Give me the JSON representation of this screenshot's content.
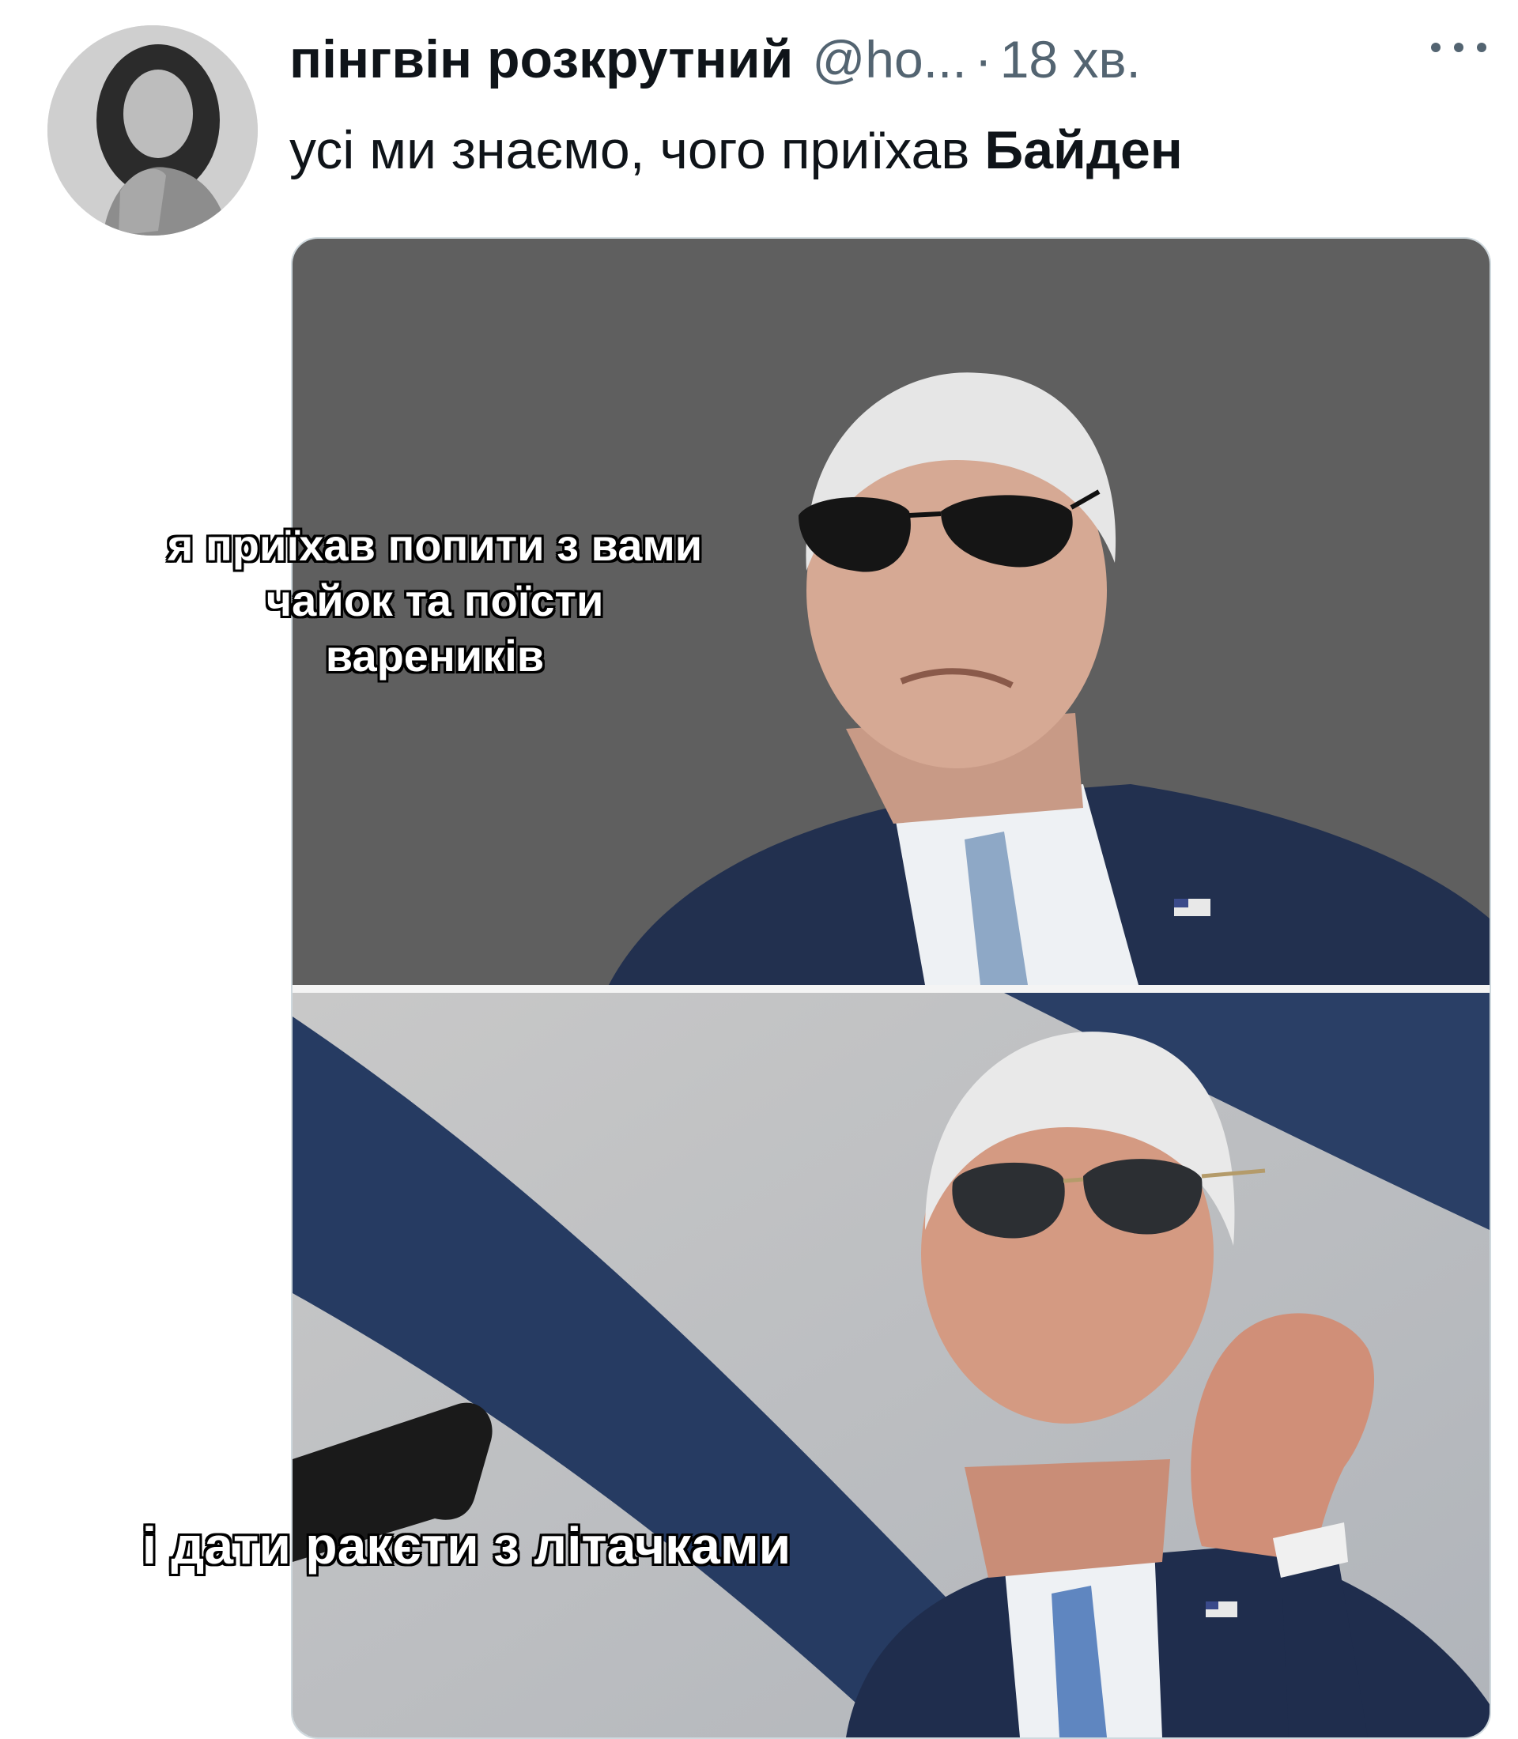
{
  "tweet": {
    "author_name": "пінгвін розкрутний",
    "handle": "@ho...",
    "separator": "·",
    "time": "18 хв.",
    "text_prefix": "усі ми знаємо, чого приїхав ",
    "text_bold": "Байден"
  },
  "meme": {
    "top_caption_lines": [
      "я приїхав попити з вами",
      "чайок та поїсти",
      "вареників"
    ],
    "bottom_caption": "і дати ракєти з літачками"
  },
  "icons": {
    "more": "more-horizontal-icon"
  },
  "colors": {
    "text_primary": "#0f1419",
    "text_secondary": "#536471",
    "media_border": "#cfd9de"
  }
}
